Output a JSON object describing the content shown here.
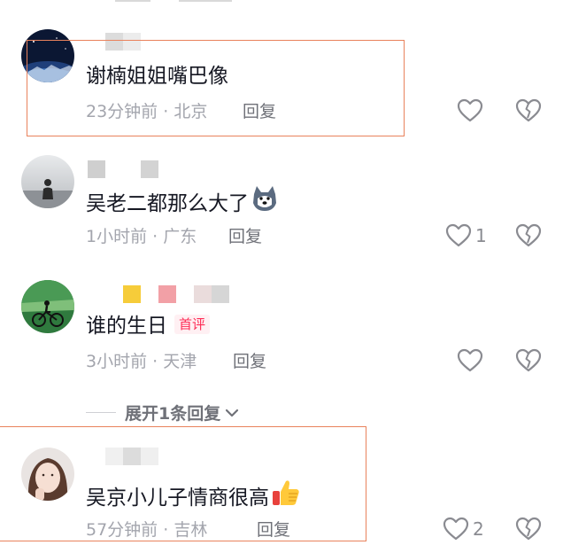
{
  "comments": [
    {
      "text": "谢楠姐姐嘴巴像",
      "time": "23分钟前",
      "location": "北京",
      "reply_label": "回复",
      "like_count": ""
    },
    {
      "text": "吴老二都那么大了",
      "time": "1小时前",
      "location": "广东",
      "reply_label": "回复",
      "like_count": "1"
    },
    {
      "text": "谁的生日",
      "badge": "首评",
      "time": "3小时前",
      "location": "天津",
      "reply_label": "回复",
      "like_count": ""
    },
    {
      "text": "吴京小儿子情商很高",
      "time": "57分钟前",
      "location": "吉林",
      "reply_label": "回复",
      "like_count": "2"
    }
  ],
  "expand_replies": {
    "label": "展开1条回复"
  },
  "meta_separator": "·",
  "colors": {
    "highlight_box": "#e9825c",
    "badge_text": "#fe2c55",
    "meta_text": "#a3a5ad"
  },
  "icons": [
    "heart-outline-icon",
    "broken-heart-icon",
    "chevron-down-icon",
    "husky-emoji",
    "thumbs-up-emoji"
  ]
}
